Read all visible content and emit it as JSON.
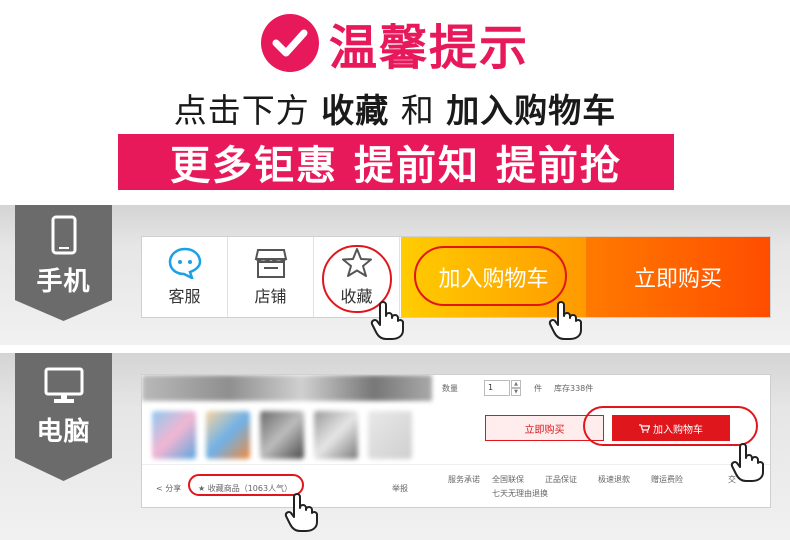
{
  "header": {
    "title": "温馨提示",
    "subtitle_parts": [
      "点击下方",
      "收藏",
      "和",
      "加入购物车"
    ],
    "banner": "更多钜惠 提前知 提前抢"
  },
  "phone": {
    "tag_label": "手机",
    "items": [
      {
        "label": "客服",
        "icon": "chat-bubble-icon"
      },
      {
        "label": "店铺",
        "icon": "shop-icon"
      },
      {
        "label": "收藏",
        "icon": "star-icon"
      }
    ],
    "add_to_cart": "加入购物车",
    "buy_now": "立即购买"
  },
  "pc": {
    "tag_label": "电脑",
    "quantity_label": "数量",
    "quantity_value": "1",
    "unit": "件",
    "stock": "库存338件",
    "buy_now": "立即购买",
    "add_to_cart": "加入购物车",
    "share": "分享",
    "favorite": "收藏商品（1063人气）",
    "report": "举报",
    "service_label": "服务承诺",
    "services": [
      "全国联保",
      "正品保证",
      "极速退款",
      "赠运费险"
    ],
    "service_extra": "七天无理由退换",
    "more": "交"
  },
  "colors": {
    "accent": "#e8195a",
    "ring": "#e0161d",
    "cart_gradient": [
      "#ffcc00",
      "#ff9a00"
    ],
    "buy_gradient": [
      "#ff7a00",
      "#ff4d00"
    ],
    "tag_gray": "#6b6b6b"
  }
}
